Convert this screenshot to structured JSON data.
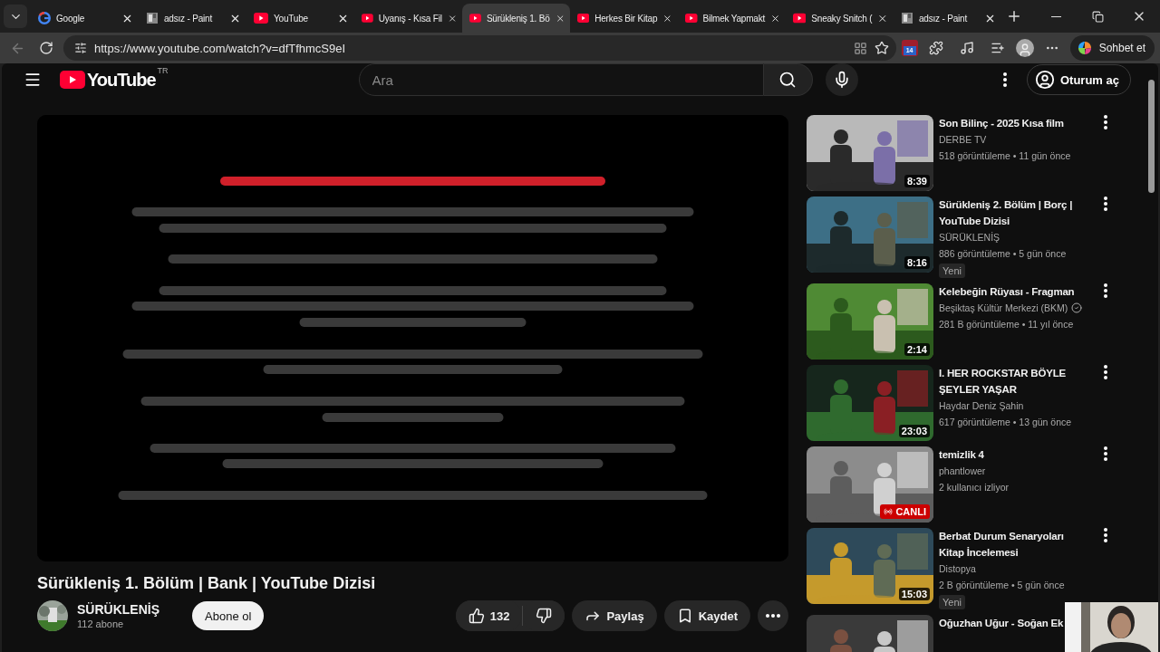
{
  "browser": {
    "tabs": [
      {
        "title": "Google",
        "kind": "google",
        "selected": false
      },
      {
        "title": "adsız - Paint",
        "kind": "paint",
        "selected": false
      },
      {
        "title": "YouTube",
        "kind": "youtube",
        "selected": false
      },
      {
        "title": "Uyanış - Kısa Fil",
        "kind": "youtube",
        "selected": false
      },
      {
        "title": "Sürükleniş 1. Bö",
        "kind": "youtube",
        "selected": true
      },
      {
        "title": "Herkes Bir Kitap",
        "kind": "youtube",
        "selected": false
      },
      {
        "title": "Bilmek Yapmakt",
        "kind": "youtube",
        "selected": false
      },
      {
        "title": "Sneaky Snitch (",
        "kind": "youtube",
        "selected": false
      },
      {
        "title": "adsız - Paint",
        "kind": "paint",
        "selected": false
      }
    ],
    "url": "https://www.youtube.com/watch?v=dfTfhmcS9eI",
    "calendar_badge": "14",
    "chat_button": "Sohbet et"
  },
  "header": {
    "logo": "YouTube",
    "region": "TR",
    "search_placeholder": "Ara",
    "sign_in": "Oturum aç"
  },
  "video": {
    "title": "Sürükleniş 1. Bölüm | Bank | YouTube Dizisi",
    "channel": "SÜRÜKLENİŞ",
    "subscribers": "112 abone",
    "subscribe": "Abone ol",
    "likes": "132",
    "share": "Paylaş",
    "save": "Kaydet"
  },
  "recommendations": [
    {
      "title": "Son Bilinç - 2025 Kısa film",
      "channel": "DERBE TV",
      "verified": false,
      "stats": "518 görüntüleme • 11 gün önce",
      "overlay": {
        "kind": "duration",
        "text": "8:39"
      }
    },
    {
      "title": "Sürükleniş 2. Bölüm | Borç | YouTube Dizisi",
      "channel": "SÜRÜKLENİŞ",
      "verified": false,
      "stats": "886 görüntüleme • 5 gün önce",
      "badge": "Yeni",
      "overlay": {
        "kind": "duration",
        "text": "8:16"
      }
    },
    {
      "title": "Kelebeğin Rüyası - Fragman",
      "channel": "Beşiktaş Kültür Merkezi (BKM)",
      "verified": true,
      "stats": "281 B görüntüleme • 11 yıl önce",
      "overlay": {
        "kind": "duration",
        "text": "2:14"
      }
    },
    {
      "title": "I. HER ROCKSTAR BÖYLE ŞEYLER YAŞAR",
      "channel": "Haydar Deniz Şahin",
      "verified": false,
      "stats": "617 görüntüleme • 13 gün önce",
      "overlay": {
        "kind": "duration",
        "text": "23:03"
      }
    },
    {
      "title": "temizlik 4",
      "channel": "phantlower",
      "verified": false,
      "stats": "2 kullanıcı izliyor",
      "overlay": {
        "kind": "live",
        "text": "CANLI"
      }
    },
    {
      "title": "Berbat Durum Senaryoları Kitap İncelemesi",
      "channel": "Distopya",
      "verified": false,
      "stats": "2 B görüntüleme • 5 gün önce",
      "badge": "Yeni",
      "overlay": {
        "kind": "duration",
        "text": "15:03"
      }
    },
    {
      "title": "Oğuzhan Uğur - Soğan Ek"
    }
  ]
}
